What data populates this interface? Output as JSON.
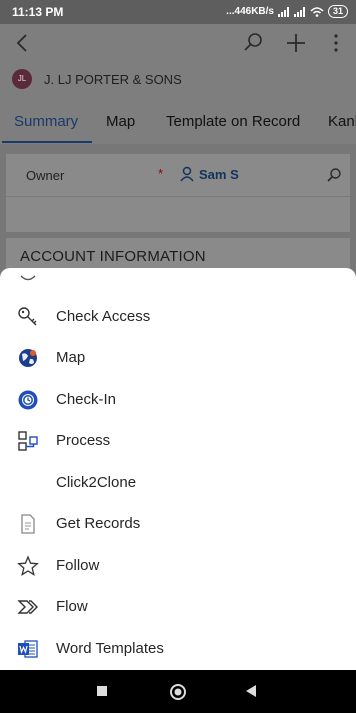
{
  "status_bar": {
    "time": "11:13 PM",
    "network": "...446KB/s",
    "battery": "31"
  },
  "record": {
    "avatar_initials": "JL",
    "name": "J. LJ PORTER & SONS"
  },
  "tabs": [
    {
      "label": "Summary"
    },
    {
      "label": "Map"
    },
    {
      "label": "Template on Record"
    },
    {
      "label": "Kanb"
    }
  ],
  "form": {
    "owner_label": "Owner",
    "required_mark": "*",
    "owner_value": "Sam S",
    "section_title": "ACCOUNT INFORMATION"
  },
  "menu": {
    "items": [
      {
        "label": "Check Access",
        "icon": "key-icon"
      },
      {
        "label": "Map",
        "icon": "globe-icon"
      },
      {
        "label": "Check-In",
        "icon": "checkin-icon"
      },
      {
        "label": "Process",
        "icon": "process-icon"
      },
      {
        "label": "Click2Clone",
        "icon": ""
      },
      {
        "label": "Get Records",
        "icon": "document-icon"
      },
      {
        "label": "Follow",
        "icon": "star-icon"
      },
      {
        "label": "Flow",
        "icon": "flow-icon"
      },
      {
        "label": "Word Templates",
        "icon": "word-icon"
      }
    ]
  },
  "colors": {
    "accent": "#1a3a6a",
    "overlay": "#7e7e7e",
    "sheet": "#ffffff"
  }
}
